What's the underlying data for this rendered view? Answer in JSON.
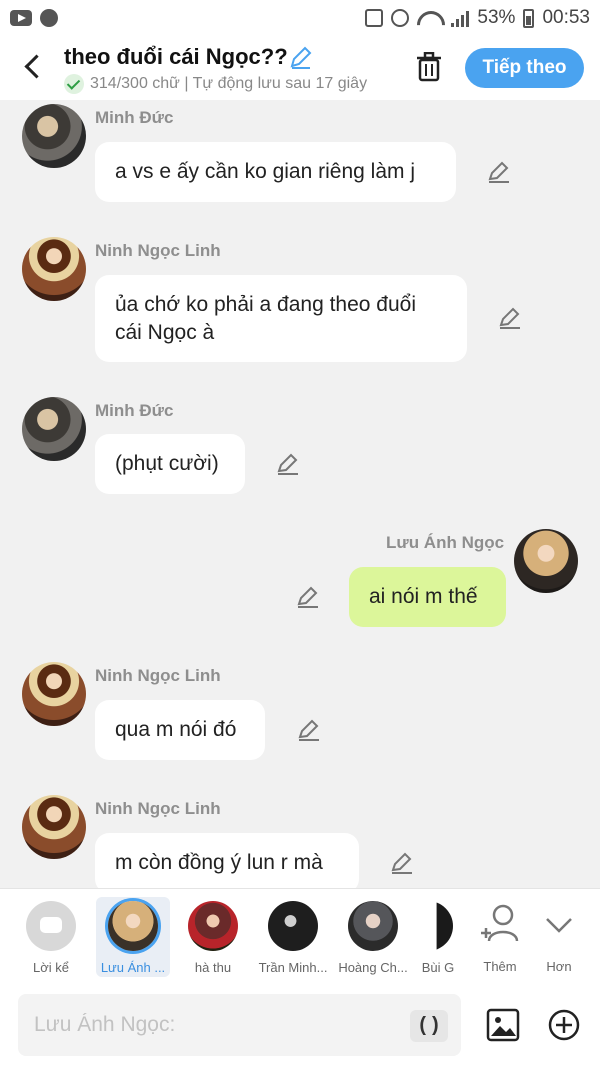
{
  "status_bar": {
    "battery": "53%",
    "time": "00:53",
    "icons": [
      "youtube-icon",
      "globe-icon",
      "signal-icon",
      "alarm-icon",
      "wifi-icon",
      "battery-icon"
    ]
  },
  "header": {
    "title": "theo đuổi cái Ngọc??",
    "subtitle": "314/300 chữ | Tự động lưu sau 17 giây",
    "next_label": "Tiếp theo"
  },
  "messages": [
    {
      "sender": "Minh Đức",
      "text": "a vs e ấy cần ko gian riêng làm j",
      "mine": false
    },
    {
      "sender": "Ninh Ngọc Linh",
      "text": "ủa chớ ko phải a đang theo đuổi cái Ngọc à",
      "mine": false
    },
    {
      "sender": "Minh Đức",
      "text": "(phụt cười)",
      "mine": false
    },
    {
      "sender": "Lưu Ánh Ngọc",
      "text": "ai nói m thế",
      "mine": true
    },
    {
      "sender": "Ninh Ngọc Linh",
      "text": "qua m nói đó",
      "mine": false
    },
    {
      "sender": "Ninh Ngọc Linh",
      "text": "m còn đồng ý lun r mà",
      "mine": false
    }
  ],
  "suggestions": [
    {
      "label": "Lời kể"
    },
    {
      "label": "Lưu Ánh ..."
    },
    {
      "label": "hà thu"
    },
    {
      "label": "Trần Minh..."
    },
    {
      "label": "Hoàng Ch..."
    },
    {
      "label": "Bùi G"
    },
    {
      "label": "Thêm"
    },
    {
      "label": "Hơn"
    }
  ],
  "input": {
    "placeholder": "Lưu Ánh Ngọc:",
    "paren_label": "()"
  },
  "colors": {
    "accent": "#4aa3f0",
    "my_bubble": "#dcf69a",
    "other_bubble": "#ffffff",
    "background": "#f1f1f1"
  }
}
